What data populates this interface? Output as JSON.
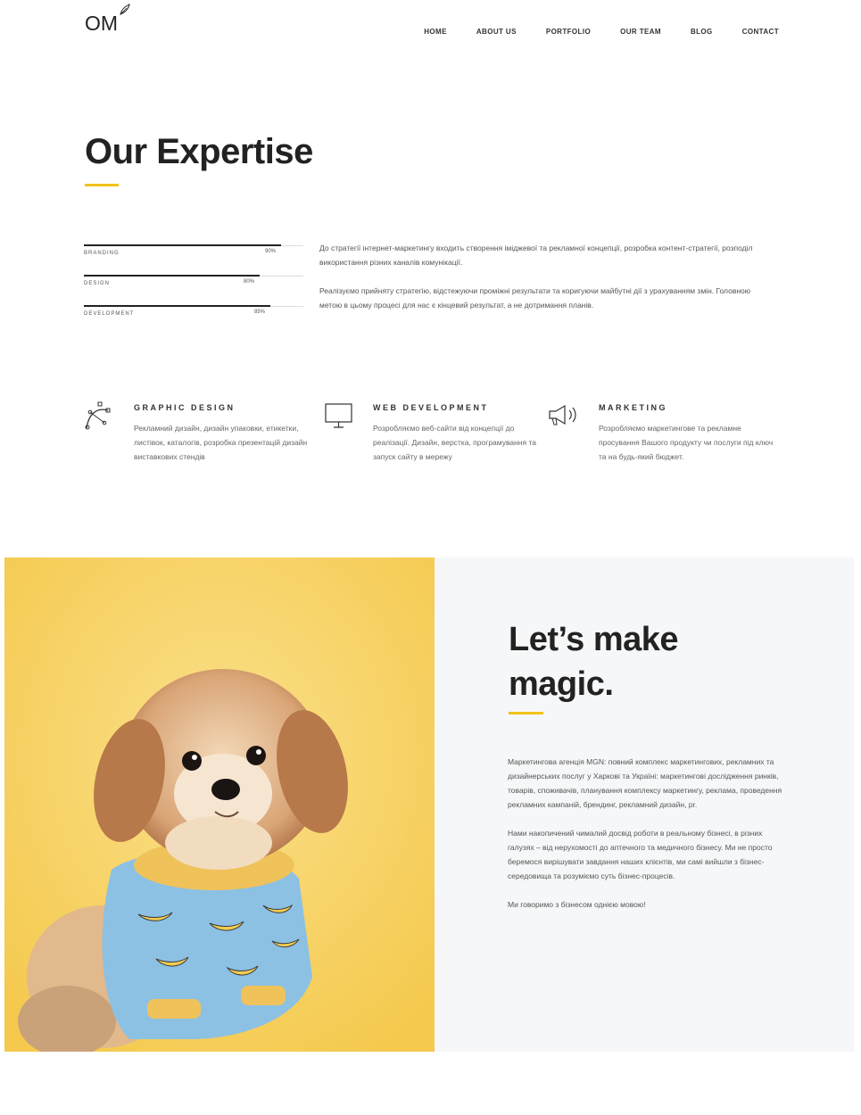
{
  "header": {
    "logo_text": "OM",
    "nav": [
      "HOME",
      "ABOUT US",
      "PORTFOLIO",
      "OUR TEAM",
      "BLOG",
      "CONTACT"
    ]
  },
  "expertise": {
    "title": "Our Expertise",
    "skills": [
      {
        "label": "BRANDING",
        "percent_text": "90%",
        "value": 0.9
      },
      {
        "label": "DESIGN",
        "percent_text": "80%",
        "value": 0.8
      },
      {
        "label": "DEVELOPMENT",
        "percent_text": "85%",
        "value": 0.85
      }
    ],
    "paragraphs": [
      "До стратегії інтернет-маркетингу входить створення іміджевої та рекламної концепції, розробка контент-стратегії, розподіл використання різних каналів комунікації.",
      "Реалізуємо прийняту стратегію, відстежуючи проміжні результати та коригуючи майбутні дії з урахуванням змін. Головною метою в цьому процесі для нас є кінцевий результат, а не дотримання планів."
    ]
  },
  "services": [
    {
      "icon": "bezier-pen-icon",
      "title": "GRAPHIC DESIGN",
      "text": "Рекламний дизайн, дизайн упаковки, етикетки, листівок, каталогів, розробка презентацій дизайн виставкових стендів"
    },
    {
      "icon": "monitor-icon",
      "title": "WEB DEVELOPMENT",
      "text": "Розробляємо веб-сайти від концепції до реалізації. Дизайн, верстка, програмування та запуск сайту в мережу"
    },
    {
      "icon": "megaphone-icon",
      "title": "MARKETING",
      "text": "Розробляємо маркетингове та рекламне просування Вашого продукту чи послуги під ключ та на будь-який бюджет."
    }
  ],
  "magic": {
    "title_line1": "Let’s make",
    "title_line2": "magic.",
    "paragraphs": [
      "Маркетингова агенція MGN: повний комплекс маркетингових, рекламних та дизайнерських послуг у Харкові та Україні: маркетингові дослідження ринків, товарів, споживачів, планування комплексу маркетингу, реклама, проведення рекламних кампаній, брендинг, рекламний дизайн, pr.",
      "Нами накопичений чималий досвід роботи в реальному бізнесі, в різних галузях – від нерухомості до аптечного та медичного бізнесу. Ми не просто беремося вирішувати завдання наших клієнтів, ми самі вийшли з бізнес-середовища та розуміємо суть бізнес-процесів.",
      "Ми говоримо з бізнесом однією мовою!"
    ]
  },
  "colors": {
    "accent": "#f2c21a",
    "photo_bg": "#f6cf5a",
    "panel_bg": "#f6f7f8"
  }
}
